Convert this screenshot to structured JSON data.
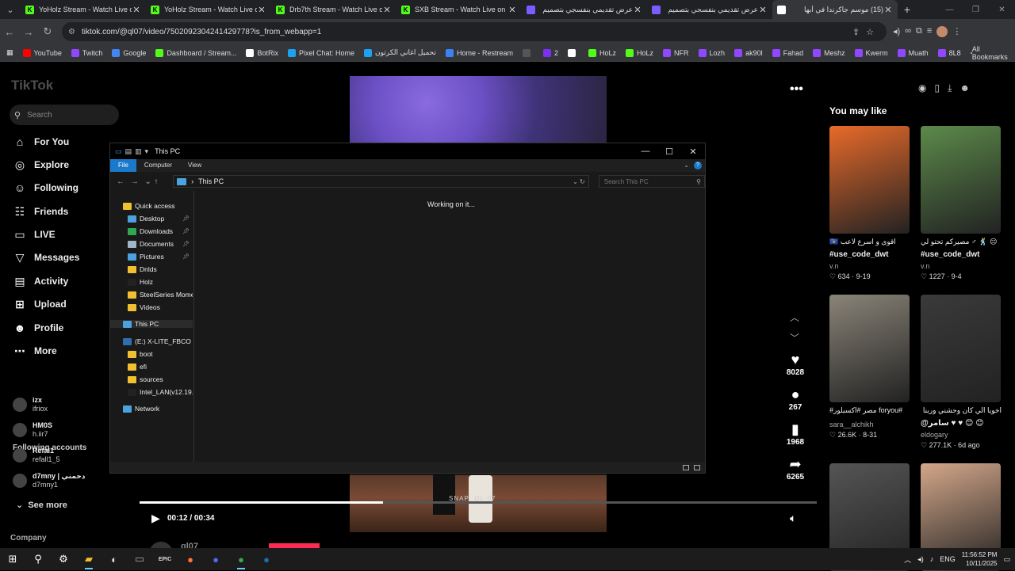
{
  "browser": {
    "tabs": [
      {
        "title": "YoHolz Stream - Watch Live on Kick",
        "fav_color": "#53fc18",
        "fav_text": "K",
        "rtl": false
      },
      {
        "title": "YoHolz Stream - Watch Live on Kick",
        "fav_color": "#53fc18",
        "fav_text": "K",
        "rtl": false
      },
      {
        "title": "Drb7th Stream - Watch Live on Kick",
        "fav_color": "#53fc18",
        "fav_text": "K",
        "rtl": false
      },
      {
        "title": "SXB Stream - Watch Live on Kick",
        "fav_color": "#53fc18",
        "fav_text": "K",
        "rtl": false
      },
      {
        "title": "عرض تقديمي بنفسجي بتصميم",
        "fav_color": "#7b5cff",
        "fav_text": "",
        "rtl": true
      },
      {
        "title": "عرض تقديمي بنفسجي بتصميم",
        "fav_color": "#7b5cff",
        "fav_text": "",
        "rtl": true
      },
      {
        "title": "(15) موسم جاكرندا في أبها",
        "fav_color": "#ffffff",
        "fav_text": "",
        "rtl": true
      }
    ],
    "url": "tiktok.com/@ql07/video/7502092304241429778?is_from_webapp=1",
    "bookmarks": [
      "YouTube",
      "Twitch",
      "Google",
      "Dashboard / Stream...",
      "BotRix",
      "Pixel Chat: Home",
      "تحميل اغاني الكرتون",
      "Home - Restream",
      "",
      "2",
      "",
      "HoLz",
      "HoLz",
      "NFR",
      "Lozh",
      "ak90l",
      "Fahad",
      "Meshz",
      "Kwerm",
      "Muath",
      "8L8"
    ],
    "bookmark_colors": [
      "#ff0000",
      "#9146ff",
      "#4285f4",
      "#53fc18",
      "#ffffff",
      "#1da1f2",
      "#1da1f2",
      "#3b82f6",
      "#555555",
      "#7b2ff7",
      "#ffffff",
      "#53fc18",
      "#53fc18",
      "#9146ff",
      "#9146ff",
      "#9146ff",
      "#9146ff",
      "#9146ff",
      "#9146ff",
      "#9146ff",
      "#9146ff"
    ],
    "all_bookmarks": "All Bookmarks"
  },
  "tiktok": {
    "logo": "TikTok",
    "search_placeholder": "Search",
    "nav": [
      {
        "label": "For You",
        "icon": "⌂"
      },
      {
        "label": "Explore",
        "icon": "◎"
      },
      {
        "label": "Following",
        "icon": "☺"
      },
      {
        "label": "Friends",
        "icon": "☷"
      },
      {
        "label": "LIVE",
        "icon": "▭"
      },
      {
        "label": "Messages",
        "icon": "▽",
        "badge": "15"
      },
      {
        "label": "Activity",
        "icon": "▤"
      },
      {
        "label": "Upload",
        "icon": "⊞"
      },
      {
        "label": "Profile",
        "icon": "☻"
      },
      {
        "label": "More",
        "icon": "⋯"
      }
    ],
    "following_title": "Following accounts",
    "accounts": [
      {
        "name": "izx",
        "handle": "ifriox"
      },
      {
        "name": "HM0S",
        "handle": "h.iir7"
      },
      {
        "name": "Refal1",
        "handle": "refall1_5"
      },
      {
        "name": "d7mny | دحمني",
        "handle": "d7mny1"
      }
    ],
    "see_more": "See more",
    "company": "Company",
    "video": {
      "time": "00:12 / 00:34",
      "progress": 0.36,
      "watermark": "SNAP: QL-07",
      "author": "ql07"
    },
    "actions": [
      {
        "icon": "♥",
        "count": "8028"
      },
      {
        "icon": "●",
        "count": "267"
      },
      {
        "icon": "▮",
        "count": "1968"
      },
      {
        "icon": "➦",
        "count": "6265"
      }
    ],
    "you_may_like": "You may like",
    "recommendations": [
      {
        "caption": "اقوى و اسرع لاعب 🇽🇰",
        "tag": "#use_code_dwt",
        "author": "v.n",
        "likes": "634",
        "date": "9-19",
        "color": "#e86a2a"
      },
      {
        "caption": "😑 🕺 ♂ مصيركم تحتو لي",
        "tag": "#use_code_dwt",
        "author": "v.n",
        "likes": "1227",
        "date": "9-4",
        "color": "#5c8a4a"
      },
      {
        "caption": "#foryou مصر #اكسبلور#",
        "tag": "",
        "author": "sara__alchikh",
        "likes": "26.6K",
        "date": "8-31",
        "color": "#8a8478"
      },
      {
        "caption": "اخويا الي كان وحشني وربنا ...",
        "tag": "@سامر ♥ ♥ 😊 😊",
        "author": "eldogary",
        "likes": "277.1K",
        "date": "6d ago",
        "color": "#3a3a3a"
      },
      {
        "caption": "",
        "tag": "",
        "author": "",
        "likes": "",
        "date": "",
        "color": "#555555"
      },
      {
        "caption": "",
        "tag": "",
        "author": "",
        "likes": "",
        "date": "",
        "color": "#d4a78a"
      }
    ]
  },
  "explorer": {
    "title": "This PC",
    "ribbon": [
      "File",
      "Computer",
      "View"
    ],
    "path": "This PC",
    "search_placeholder": "Search This PC",
    "status": "Working on it...",
    "tree": [
      {
        "label": "Quick access",
        "color": "#f0c030",
        "indent": 0,
        "pin": false
      },
      {
        "label": "Desktop",
        "color": "#4aa3df",
        "indent": 1,
        "pin": true
      },
      {
        "label": "Downloads",
        "color": "#2fa84f",
        "indent": 1,
        "pin": true
      },
      {
        "label": "Documents",
        "color": "#9fb6c8",
        "indent": 1,
        "pin": true
      },
      {
        "label": "Pictures",
        "color": "#4aa3df",
        "indent": 1,
        "pin": true
      },
      {
        "label": "Dnlds",
        "color": "#f0c030",
        "indent": 1,
        "pin": false
      },
      {
        "label": "Holz",
        "color": "#222222",
        "indent": 1,
        "pin": false
      },
      {
        "label": "SteelSeries Moments",
        "color": "#f0c030",
        "indent": 1,
        "pin": false
      },
      {
        "label": "Videos",
        "color": "#f0c030",
        "indent": 1,
        "pin": false
      },
      {
        "label": "This PC",
        "color": "#4aa3df",
        "indent": 0,
        "pin": false,
        "sel": true
      },
      {
        "label": "(E:) X-LITE_FBCO",
        "color": "#2f6fb0",
        "indent": 0,
        "pin": false
      },
      {
        "label": "boot",
        "color": "#f0c030",
        "indent": 1,
        "pin": false
      },
      {
        "label": "efi",
        "color": "#f0c030",
        "indent": 1,
        "pin": false
      },
      {
        "label": "sources",
        "color": "#f0c030",
        "indent": 1,
        "pin": false
      },
      {
        "label": "Intel_LAN(v12.19.1.32",
        "color": "#222222",
        "indent": 1,
        "pin": false
      },
      {
        "label": "Network",
        "color": "#4aa3df",
        "indent": 0,
        "pin": false
      }
    ]
  },
  "taskbar": {
    "apps": [
      {
        "name": "start",
        "icon": "⊞",
        "color": "#ffffff"
      },
      {
        "name": "search",
        "icon": "⚲",
        "color": "#ffffff"
      },
      {
        "name": "settings",
        "icon": "⚙",
        "color": "#ffffff"
      },
      {
        "name": "file-explorer",
        "icon": "▰",
        "color": "#f0c030",
        "active": true
      },
      {
        "name": "app-k",
        "icon": "◐",
        "color": "#dddddd"
      },
      {
        "name": "app-box",
        "icon": "▭",
        "color": "#aaaaaa"
      },
      {
        "name": "epic",
        "icon": "EPIC",
        "color": "#dddddd"
      },
      {
        "name": "firefox",
        "icon": "●",
        "color": "#ff7139"
      },
      {
        "name": "discord",
        "icon": "●",
        "color": "#5865f2"
      },
      {
        "name": "chrome",
        "icon": "●",
        "color": "#34a853",
        "active": true
      },
      {
        "name": "steam",
        "icon": "●",
        "color": "#1b6fb0"
      }
    ],
    "lang": "ENG",
    "time": "11:56:52 PM",
    "date": "10/11/2025"
  }
}
